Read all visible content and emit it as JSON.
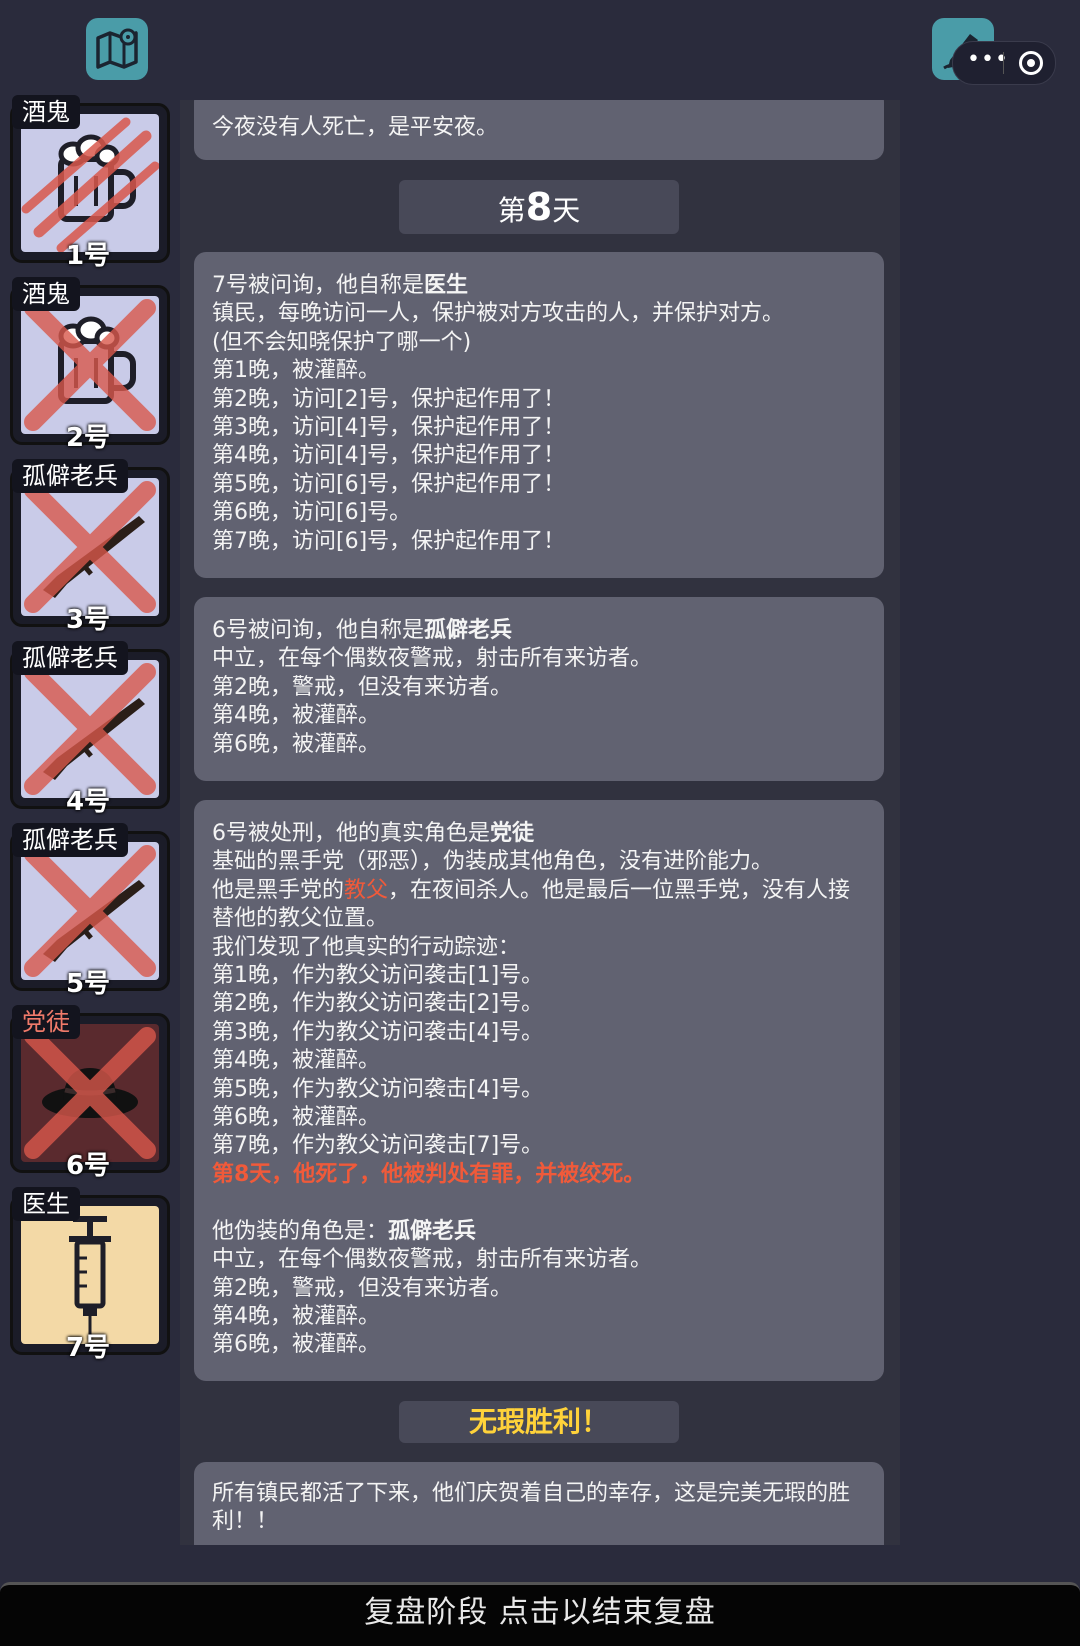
{
  "header": {
    "map_icon": "map-pin-icon",
    "notes_icon": "pen-notes-icon",
    "capsule_more": "•••"
  },
  "players": [
    {
      "role": "酒鬼",
      "number": "1号",
      "icon": "beer-mug-icon",
      "mark": "claw-slash",
      "theme": "lavender"
    },
    {
      "role": "酒鬼",
      "number": "2号",
      "icon": "beer-mug-icon",
      "mark": "x",
      "theme": "lavender"
    },
    {
      "role": "孤僻老兵",
      "number": "3号",
      "icon": "rifle-icon",
      "mark": "x",
      "theme": "lavender"
    },
    {
      "role": "孤僻老兵",
      "number": "4号",
      "icon": "rifle-icon",
      "mark": "x",
      "theme": "lavender"
    },
    {
      "role": "孤僻老兵",
      "number": "5号",
      "icon": "rifle-icon",
      "mark": "x",
      "theme": "lavender"
    },
    {
      "role": "党徒",
      "number": "6号",
      "icon": "fedora-hat-icon",
      "mark": "x",
      "theme": "dark-red"
    },
    {
      "role": "医生",
      "number": "7号",
      "icon": "syringe-icon",
      "mark": "none",
      "theme": "cream"
    }
  ],
  "log": {
    "night_note": "今夜没有人死亡，是平安夜。",
    "day_prefix": "第",
    "day_number": "8",
    "day_suffix": "天",
    "p1": {
      "intro": "7号被问询，他自称是",
      "role": "医生",
      "lines": [
        "镇民，每晚访问一人，保护被对方攻击的人，并保护对方。",
        "(但不会知晓保护了哪一个)",
        "第1晚，被灌醉。",
        "第2晚，访问[2]号，保护起作用了！",
        "第3晚，访问[4]号，保护起作用了！",
        "第4晚，访问[4]号，保护起作用了！",
        "第5晚，访问[6]号，保护起作用了！",
        "第6晚，访问[6]号。",
        "第7晚，访问[6]号，保护起作用了！"
      ]
    },
    "p2": {
      "intro": "6号被问询，他自称是",
      "role": "孤僻老兵",
      "lines": [
        "中立，在每个偶数夜警戒，射击所有来访者。",
        "第2晚，警戒，但没有来访者。",
        "第4晚，被灌醉。",
        "第6晚，被灌醉。"
      ]
    },
    "p3": {
      "intro": "6号被处刑，他的真实角色是",
      "role": "党徒",
      "desc": "基础的黑手党（邪恶），伪装成其他角色，没有进阶能力。",
      "godfather_pre": "他是黑手党的",
      "godfather": "教父",
      "godfather_post": "，在夜间杀人。他是最后一位黑手党，没有人接替他的教父位置。",
      "trace_title": "我们发现了他真实的行动踪迹：",
      "lines": [
        "第1晚，作为教父访问袭击[1]号。",
        "第2晚，作为教父访问袭击[2]号。",
        "第3晚，作为教父访问袭击[4]号。",
        "第4晚，被灌醉。",
        "第5晚，作为教父访问袭击[4]号。",
        "第6晚，被灌醉。",
        "第7晚，作为教父访问袭击[7]号。"
      ],
      "verdict": "第8天，他死了，他被判处有罪，并被绞死。",
      "disguise_pre": "他伪装的角色是：",
      "disguise_role": "孤僻老兵",
      "disguise_lines": [
        "中立，在每个偶数夜警戒，射击所有来访者。",
        "第2晚，警戒，但没有来访者。",
        "第4晚，被灌醉。",
        "第6晚，被灌醉。"
      ]
    },
    "victory_banner": "无瑕胜利！",
    "final": "所有镇民都活了下来，他们庆贺着自己的幸存，这是完美无瑕的胜利！！"
  },
  "footer": {
    "label": "复盘阶段 点击以结束复盘"
  },
  "colors": {
    "background": "#2a2b3c",
    "panel": "#616271",
    "accent_red": "#f05a3a",
    "victory_yellow": "#ffd23a",
    "teal_button": "#4a9ca8"
  }
}
